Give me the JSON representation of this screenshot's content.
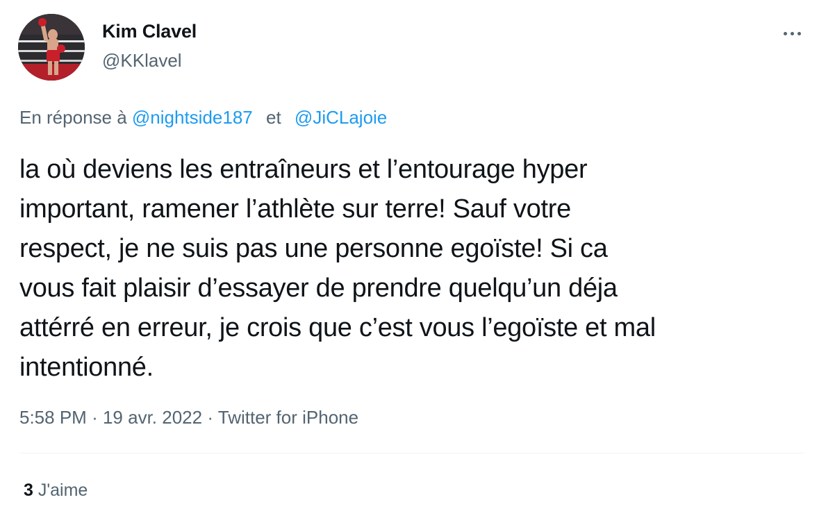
{
  "author": {
    "name": "Kim Clavel",
    "handle": "@KKlavel"
  },
  "reply": {
    "prefix": "En réponse à",
    "mentions": [
      "@nightside187",
      "@JiCLajoie"
    ],
    "joiner": "et"
  },
  "tweet": {
    "lines": [
      "la où deviens les entraîneurs et l’entourage hyper",
      "important, ramener l’athlète sur terre! Sauf votre",
      "respect, je ne suis pas une personne egoïste! Si ca",
      "vous fait plaisir d’essayer de prendre quelqu’un déja",
      "attérré en erreur, je crois que c’est vous l’egoïste et mal",
      "intentionné."
    ]
  },
  "meta": {
    "time": "5:58 PM",
    "date": "19 avr. 2022",
    "source": "Twitter for iPhone",
    "separator": "·"
  },
  "stats": {
    "likes_count": "3",
    "likes_label": "J'aime"
  },
  "icons": {
    "more": "more-horizontal-icon"
  },
  "colors": {
    "text": "#0f1419",
    "secondary": "#536471",
    "link": "#1d9bf0",
    "divider": "#eff3f4"
  }
}
